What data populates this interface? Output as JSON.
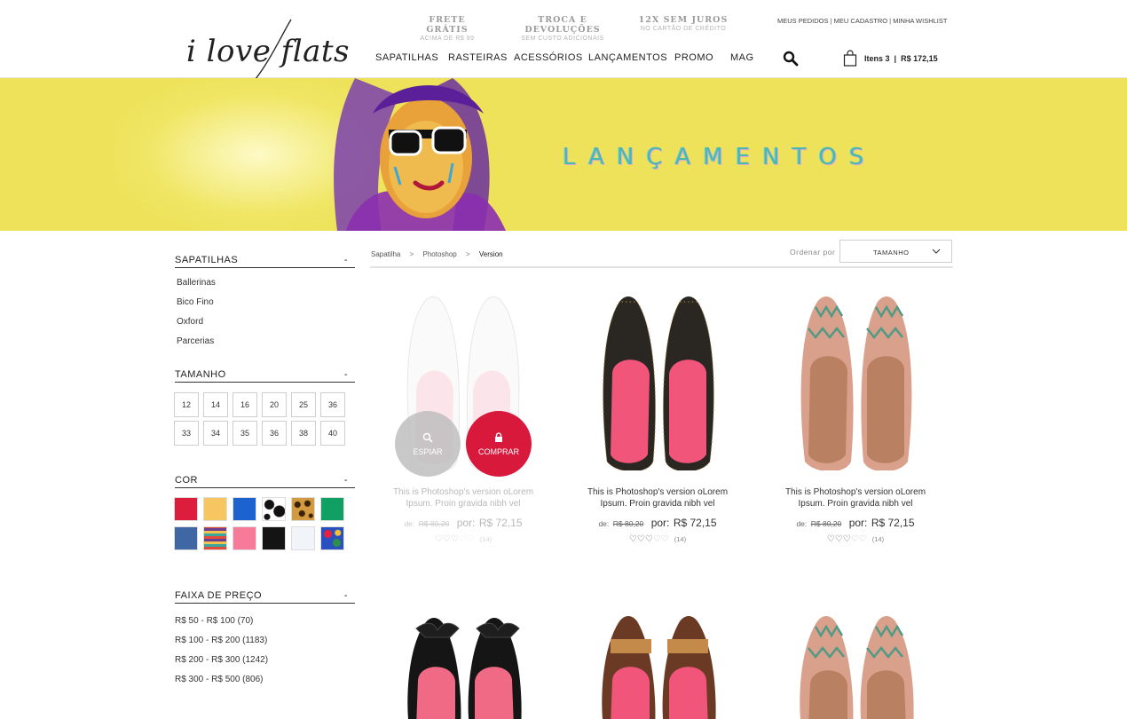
{
  "header": {
    "logo_text": "i love flats",
    "promos": [
      {
        "title": "FRETE GRÁTIS",
        "sub": "ACIMA DE R$ 99"
      },
      {
        "title": "TROCA E DEVOLUÇÕES",
        "sub": "SEM CUSTO ADICIONAIS"
      },
      {
        "title": "12X SEM JUROS",
        "sub": "NO CARTÃO DE CRÉDITO"
      }
    ],
    "user_links": [
      "MEUS PEDIDOS",
      "MEU CADASTRO",
      "MINHA WISHLIST"
    ],
    "nav": [
      "SAPATILHAS",
      "RASTEIRAS",
      "ACESSÓRIOS",
      "LANÇAMENTOS",
      "PROMO",
      "MAG"
    ],
    "cart": {
      "items_label": "Itens 3",
      "total": "R$ 172,15"
    }
  },
  "banner": {
    "title": "LANÇAMENTOS"
  },
  "sidebar": {
    "categories": {
      "title": "SAPATILHAS",
      "toggle": "-",
      "items": [
        "Ballerinas",
        "Bico Fino",
        "Oxford",
        "Parcerias"
      ]
    },
    "sizes": {
      "title": "TAMANHO",
      "toggle": "-",
      "values": [
        "12",
        "14",
        "16",
        "20",
        "25",
        "36",
        "33",
        "34",
        "35",
        "36",
        "38",
        "40"
      ]
    },
    "colors": {
      "title": "COR",
      "toggle": "-",
      "swatches": [
        "red",
        "yellow",
        "blue",
        "cow-print",
        "leopard-print",
        "green",
        "denim",
        "tribal-print",
        "pink",
        "black",
        "white",
        "floral-print"
      ]
    },
    "price": {
      "title": "FAIXA DE PREÇO",
      "toggle": "-",
      "ranges": [
        "R$ 50 - R$ 100 (70)",
        "R$ 100 - R$ 200 (1183)",
        "R$ 200 - R$ 300 (1242)",
        "R$ 300 - R$ 500 (806)"
      ]
    }
  },
  "breadcrumb": [
    "Sapatilha",
    ">",
    "Photoshop",
    ">",
    "Version"
  ],
  "sort": {
    "label": "Ordenar por",
    "value": "TAMANHO"
  },
  "products": [
    {
      "name_line1": "This is Photoshop's version  oLorem",
      "name_line2": "Ipsum. Proin gravida nibh vel",
      "old_label": "de:",
      "old_price": "R$ 80,20",
      "new_label": "por:",
      "new_price": "R$ 72,15",
      "rating": 3,
      "max_rating": 5,
      "reviews": "(14)",
      "espiar": "ESPIAR",
      "comprar": "COMPRAR"
    },
    {
      "name_line1": "This is Photoshop's version  oLorem",
      "name_line2": "Ipsum. Proin gravida nibh vel",
      "old_label": "de:",
      "old_price": "R$ 80,20",
      "new_label": "por:",
      "new_price": "R$ 72,15",
      "rating": 3,
      "max_rating": 5,
      "reviews": "(14)"
    },
    {
      "name_line1": "This is Photoshop's version  oLorem",
      "name_line2": "Ipsum. Proin gravida nibh vel",
      "old_label": "de:",
      "old_price": "R$ 80,20",
      "new_label": "por:",
      "new_price": "R$ 72,15",
      "rating": 3,
      "max_rating": 5,
      "reviews": "(14)"
    }
  ],
  "colors": {
    "accent": "#d8193c",
    "banner": "#ede259",
    "banner_title": "#4ab7b0"
  }
}
